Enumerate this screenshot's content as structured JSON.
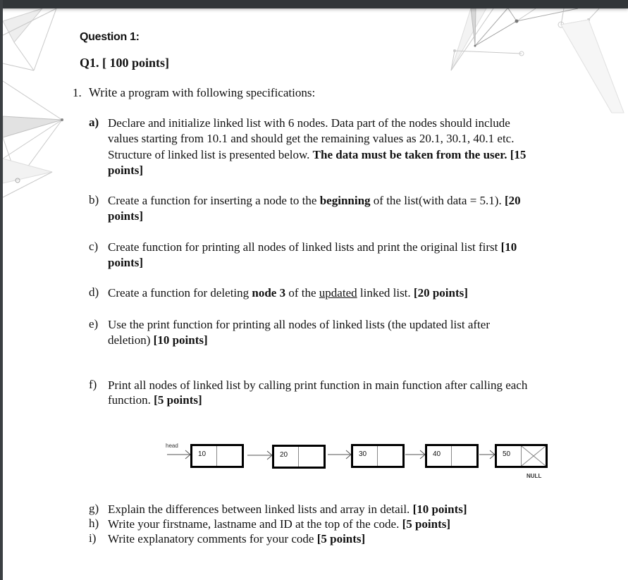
{
  "viewer": {
    "background": "#ffffff",
    "toolbar_color": "#323639"
  },
  "document": {
    "section_title": "Question 1:",
    "question_heading": "Q1. [ 100 points]",
    "task": {
      "number": "1.",
      "intro_word": "Write",
      "intro_rest": " a program with following specifications:"
    },
    "items": {
      "a": {
        "label": "a)",
        "line1": "Declare and initialize linked list with 6 nodes.  Data part of the nodes should include",
        "line2": "values starting from 10.1 and should get the remaining values as 20.1, 30.1, 40.1 etc.",
        "line3_plain": "Structure of linked list is presented below. ",
        "line3_bold": "The data must be taken from the user. [15",
        "line4_bold": "points]"
      },
      "b": {
        "label": "b)",
        "line1_plain1": "Create a function for inserting a node to the ",
        "line1_bold": "beginning",
        "line1_plain2": " of the list(with data = 5.1). ",
        "line1_bold2": "[20",
        "line2_bold": "points]"
      },
      "c": {
        "label": "c)",
        "line1_plain": "Create function for printing all nodes of linked lists and print the original list first ",
        "line1_bold": "[10",
        "line2_bold": "points]"
      },
      "d": {
        "label": "d)",
        "plain1": "Create a function for deleting ",
        "bold1": "node 3",
        "plain2": " of the ",
        "underlined": "updated",
        "plain3": " linked list. ",
        "bold2": "[20 points]"
      },
      "e": {
        "label": "e)",
        "line1": "Use the print function for printing all nodes of linked lists (the updated list after",
        "line2_plain": "deletion) ",
        "line2_bold": "[10 points]"
      },
      "f": {
        "label": "f)",
        "line1": "Print all nodes of linked list by calling print function in main function after calling each",
        "line2_plain": "function. ",
        "line2_bold": "[5 points]"
      },
      "g": {
        "label": "g)",
        "plain": "Explain the differences between linked lists and array in detail. ",
        "bold": "[10 points]"
      },
      "h": {
        "label": "h)",
        "plain": "Write your firstname, lastname and ID at the top of the code. ",
        "bold": "[5 points]"
      },
      "i": {
        "label": "i)",
        "plain": "Write explanatory comments for your code ",
        "bold": "[5 points]"
      }
    },
    "diagram": {
      "head_label": "head",
      "nodes": [
        "10",
        "20",
        "30",
        "40",
        "50"
      ],
      "null_label": "NULL"
    }
  }
}
